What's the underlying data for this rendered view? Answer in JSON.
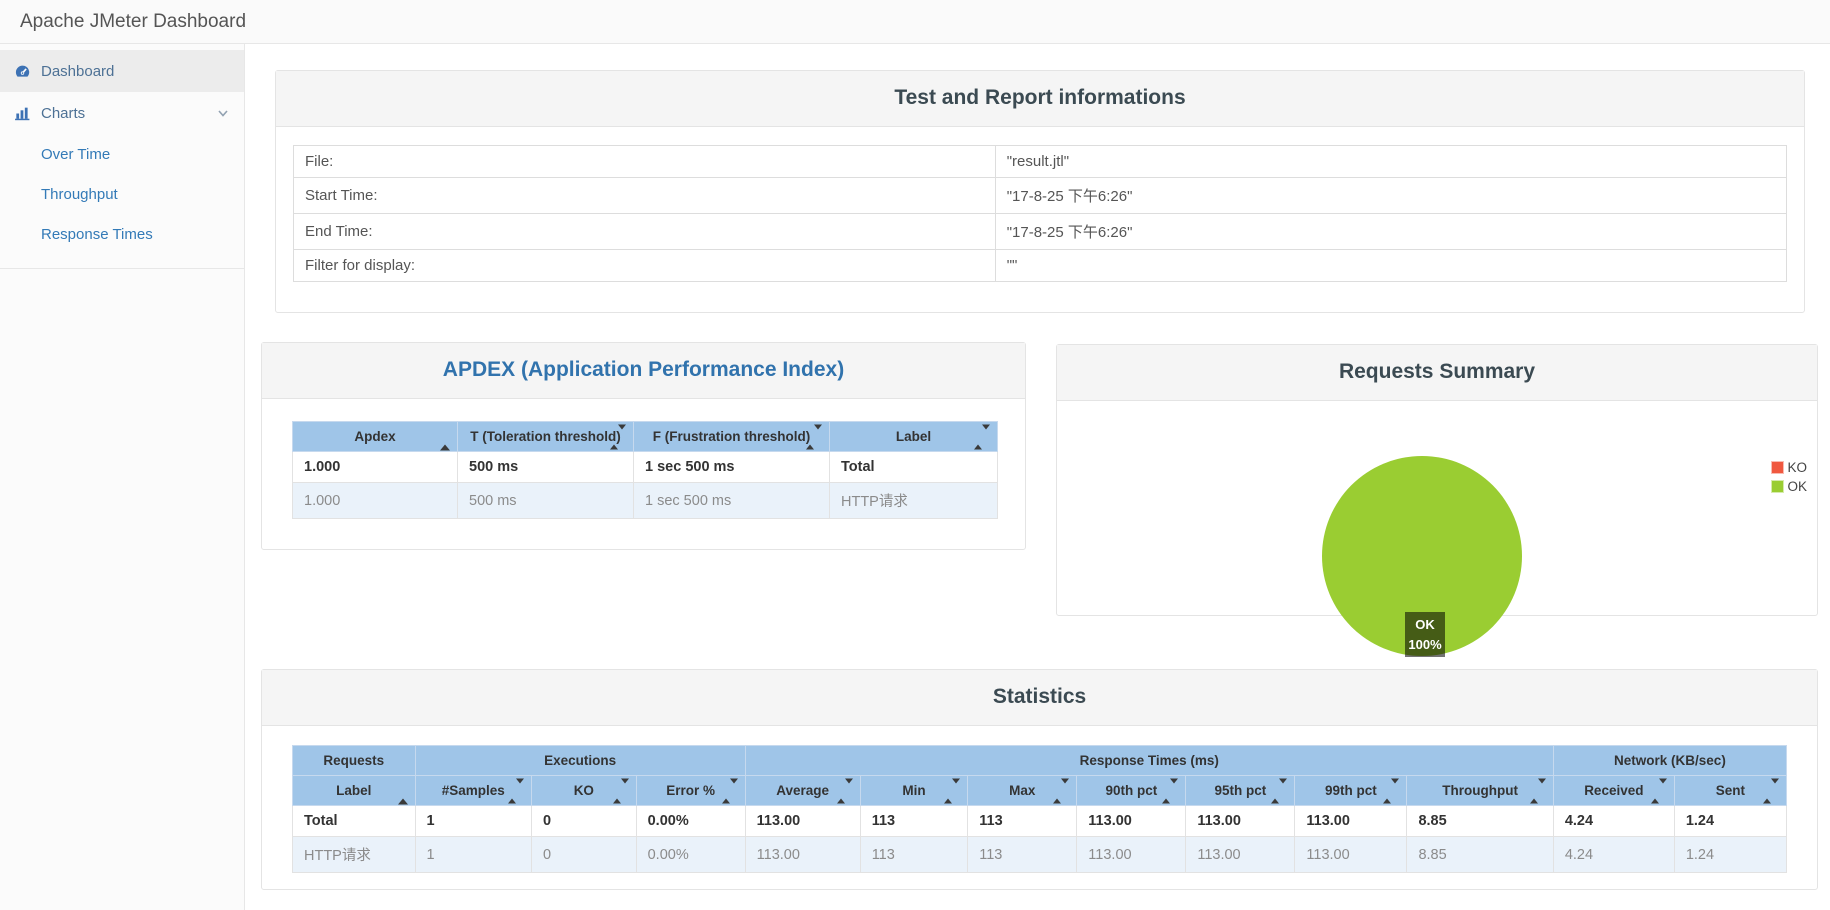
{
  "navbar": {
    "title": "Apache JMeter Dashboard"
  },
  "sidebar": {
    "items": [
      {
        "label": "Dashboard",
        "icon": "tachometer-icon",
        "active": true
      },
      {
        "label": "Charts",
        "icon": "bar-chart-icon",
        "expanded": true
      }
    ],
    "sub_items": [
      {
        "label": "Over Time"
      },
      {
        "label": "Throughput"
      },
      {
        "label": "Response Times"
      }
    ]
  },
  "info_panel": {
    "title": "Test and Report informations",
    "rows": [
      {
        "label": "File:",
        "value": "\"result.jtl\""
      },
      {
        "label": "Start Time:",
        "value": "\"17-8-25 下午6:26\""
      },
      {
        "label": "End Time:",
        "value": "\"17-8-25 下午6:26\""
      },
      {
        "label": "Filter for display:",
        "value": "\"\""
      }
    ]
  },
  "apdex_panel": {
    "title": "APDEX (Application Performance Index)",
    "columns": [
      "Apdex",
      "T (Toleration threshold)",
      "F (Frustration threshold)",
      "Label"
    ],
    "rows": [
      [
        "1.000",
        "500 ms",
        "1 sec 500 ms",
        "Total"
      ],
      [
        "1.000",
        "500 ms",
        "1 sec 500 ms",
        "HTTP请求"
      ]
    ]
  },
  "requests_summary": {
    "title": "Requests Summary",
    "legend": [
      {
        "label": "KO",
        "color": "#f0583f"
      },
      {
        "label": "OK",
        "color": "#9acd32"
      }
    ],
    "slice_label": {
      "line1": "OK",
      "line2": "100%"
    },
    "chart_data": {
      "type": "pie",
      "categories": [
        "OK",
        "KO"
      ],
      "values": [
        100,
        0
      ],
      "unit": "%",
      "colors": [
        "#9acd32",
        "#f0583f"
      ],
      "title": "Requests Summary",
      "legend_position": "right"
    }
  },
  "statistics_panel": {
    "title": "Statistics",
    "groups": [
      {
        "label": "Requests"
      },
      {
        "label": "Executions"
      },
      {
        "label": "Response Times (ms)"
      },
      {
        "label": "Network (KB/sec)"
      }
    ],
    "columns": [
      "Label",
      "#Samples",
      "KO",
      "Error %",
      "Average",
      "Min",
      "Max",
      "90th pct",
      "95th pct",
      "99th pct",
      "Throughput",
      "Received",
      "Sent"
    ],
    "rows": [
      [
        "Total",
        "1",
        "0",
        "0.00%",
        "113.00",
        "113",
        "113",
        "113.00",
        "113.00",
        "113.00",
        "8.85",
        "4.24",
        "1.24"
      ],
      [
        "HTTP请求",
        "1",
        "0",
        "0.00%",
        "113.00",
        "113",
        "113",
        "113.00",
        "113.00",
        "113.00",
        "8.85",
        "4.24",
        "1.24"
      ]
    ]
  },
  "colors": {
    "table_header_bg": "#9fc5e8",
    "table_stripe_bg": "#eaf2fa",
    "ok": "#9acd32",
    "ko": "#f0583f",
    "apdex_title": "#3173ad",
    "panel_title": "#3b4a52"
  }
}
